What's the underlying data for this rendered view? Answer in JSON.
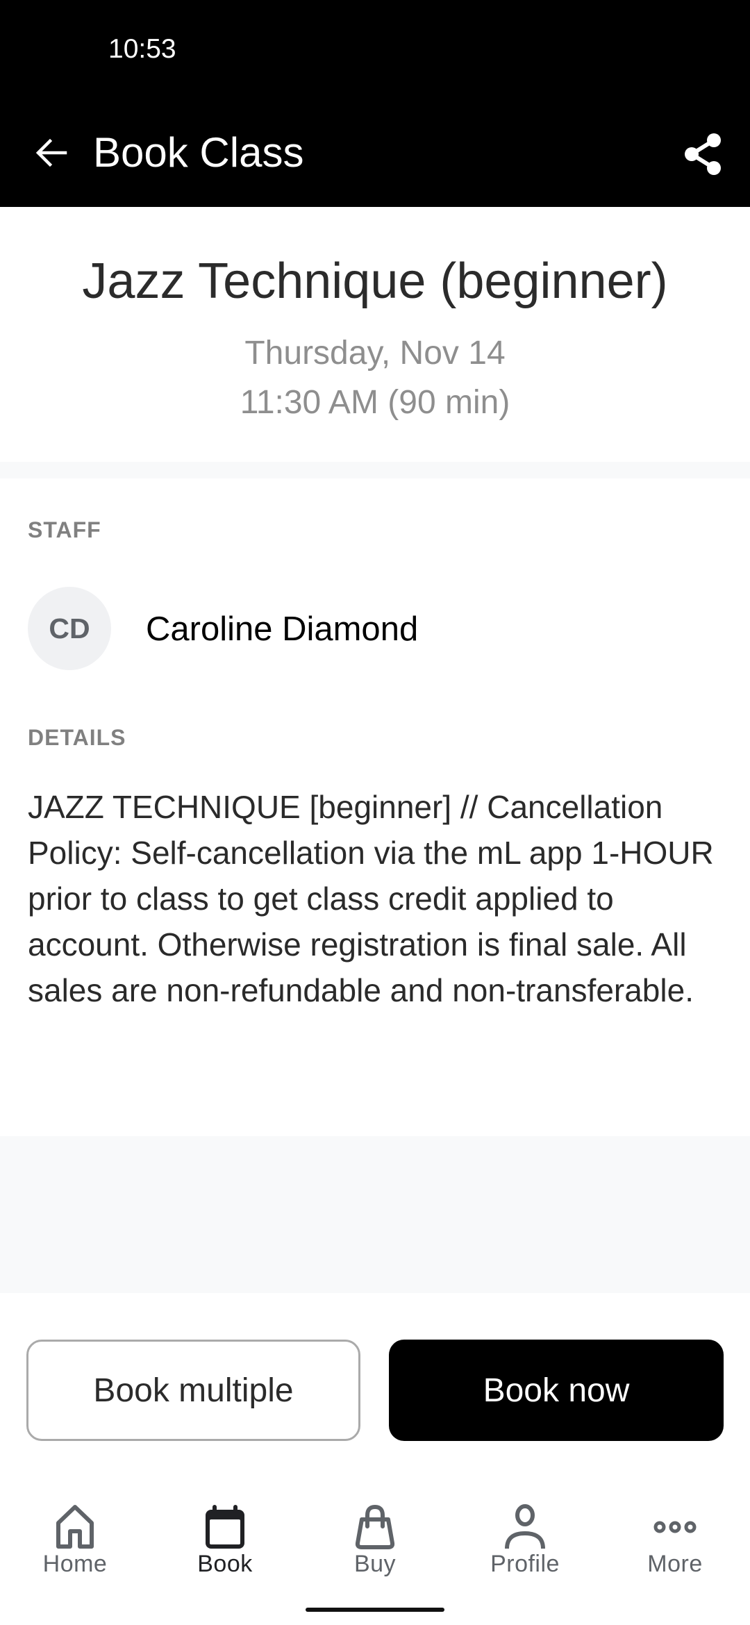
{
  "status_bar": {
    "time": "10:53"
  },
  "app_bar": {
    "title": "Book Class",
    "back_icon": "arrow-left-icon",
    "share_icon": "share-icon"
  },
  "class": {
    "title": "Jazz Technique (beginner)",
    "date": "Thursday, Nov 14",
    "time": "11:30 AM (90 min)"
  },
  "staff": {
    "section_label": "STAFF",
    "initials": "CD",
    "name": "Caroline Diamond"
  },
  "details": {
    "section_label": "DETAILS",
    "text": "JAZZ TECHNIQUE [beginner] // Cancellation Policy: Self-cancellation via the mL app 1-HOUR prior to class to get class credit applied to account. Otherwise registration is final sale. All sales are non-refundable and non-transferable."
  },
  "actions": {
    "book_multiple": "Book multiple",
    "book_now": "Book now"
  },
  "bottom_nav": {
    "active": "Book",
    "items": [
      {
        "label": "Home",
        "icon": "home-icon"
      },
      {
        "label": "Book",
        "icon": "calendar-icon"
      },
      {
        "label": "Buy",
        "icon": "shopping-bag-icon"
      },
      {
        "label": "Profile",
        "icon": "person-icon"
      },
      {
        "label": "More",
        "icon": "more-horizontal-icon"
      }
    ]
  },
  "colors": {
    "app_bar_bg": "#000000",
    "primary_button_bg": "#000000",
    "muted_text": "#8e8e8e",
    "section_label": "#808080",
    "band_bg": "#f8f9fa",
    "avatar_bg": "#f0f1f3"
  }
}
